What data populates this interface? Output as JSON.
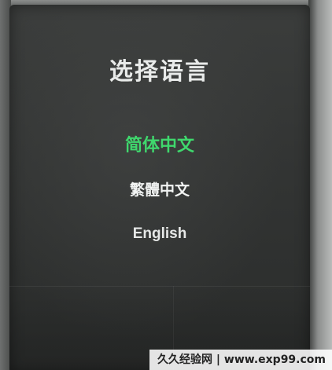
{
  "screen": {
    "title": "选择语言",
    "languages": [
      {
        "label": "简体中文",
        "selected": true
      },
      {
        "label": "繁體中文",
        "selected": false
      },
      {
        "label": "English",
        "selected": false
      }
    ],
    "selected_color": "#3fd86d"
  },
  "watermark": {
    "text": "久久经验网 | www.exp99.com"
  }
}
